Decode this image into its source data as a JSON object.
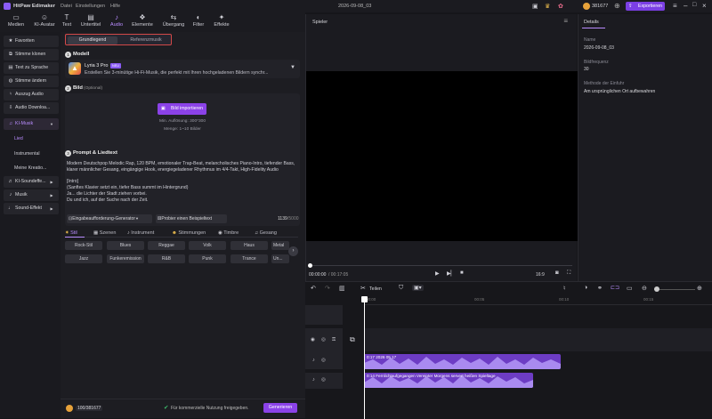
{
  "app": {
    "name": "HitPaw Edimaker",
    "menu": [
      "Datei",
      "Einstellungen",
      "Hilfe"
    ],
    "project_title": "2026-09-08_03",
    "credits": "381677",
    "export_label": "Exportieren"
  },
  "toolbar": [
    {
      "label": "Medien",
      "icon": "folder-icon"
    },
    {
      "label": "KI-Avatar",
      "icon": "avatar-icon"
    },
    {
      "label": "Text",
      "icon": "text-icon"
    },
    {
      "label": "Untertitel",
      "icon": "subtitle-icon"
    },
    {
      "label": "Audio",
      "icon": "music-icon"
    },
    {
      "label": "Elemente",
      "icon": "elements-icon"
    },
    {
      "label": "Übergang",
      "icon": "transition-icon"
    },
    {
      "label": "Filter",
      "icon": "filter-icon"
    },
    {
      "label": "Effekte",
      "icon": "effects-icon"
    }
  ],
  "sidebar": {
    "items": [
      {
        "label": "Favoriten",
        "icon": "star-icon"
      },
      {
        "label": "Stimme klonen",
        "icon": "clone-voice-icon"
      },
      {
        "label": "Text zu Sprache",
        "icon": "tts-icon"
      },
      {
        "label": "Stimme ändern",
        "icon": "voice-change-icon"
      },
      {
        "label": "Auszug Audio",
        "icon": "mic-icon"
      },
      {
        "label": "Audio Downloa...",
        "icon": "download-icon"
      },
      {
        "label": "KI-Musik",
        "icon": "ai-music-icon"
      }
    ],
    "subitems": [
      "Lied",
      "Instrumental",
      "Meine Kreatio..."
    ],
    "items2": [
      {
        "label": "KI-Soundeffe...",
        "icon": "sound-effect-icon"
      },
      {
        "label": "Musik",
        "icon": "music-note-icon"
      },
      {
        "label": "Sound-Effekt",
        "icon": "speaker-icon"
      }
    ]
  },
  "gen": {
    "tabs": [
      "Grundlegend",
      "Referenzmusik"
    ],
    "model_heading": "Modell",
    "model_name": "Lyria 3 Pro",
    "model_badge": "NEU",
    "model_desc": "Erstellen Sie 3-minütige Hi-Fi-Musik, die perfekt mit Ihren hochgeladenen Bildern synchr...",
    "image_heading": "Bild",
    "image_optional": "(Optional)",
    "import_label": "Bild importieren",
    "image_hint1": "Min. Auflösung: 300*300",
    "image_hint2": "Menge: 1~10 Bilder",
    "prompt_heading": "Prompt & Liedtext",
    "prompt_text": "Modern Deutschpop Melodic Rap, 120 BPM, emotionaler Trap-Beat, melancholisches Piano-Intro, tiefender Bass, klarer männlicher Gesang, eingängige Hook, energiegeladener Rhythmus im 4/4-Takt, High-Fidelity Audio\n\n[Intro]\n(Sanftes Klavier setzt ein, tiefer Bass summt im Hintergrund)\nJa... die Lichter der Stadt ziehen vorbei.\nDu und ich, auf der Suche nach der Zeit.",
    "prompt_gen_label": "Eingabeaufforderung-Generator",
    "example_label": "Probier einen Beispieltext",
    "char_count": "1139",
    "char_max": "/5000",
    "style_tabs": [
      "Stil",
      "Szenen",
      "Instrument",
      "Stimmungen",
      "Timbre",
      "Gesang"
    ],
    "styles_row1": [
      "Rock-Stil",
      "Blues",
      "Reggae",
      "Volk",
      "Haus",
      "Metal"
    ],
    "styles_row2": [
      "Jazz",
      "Funkeremission",
      "R&B",
      "Punk",
      "Trance",
      "Un..."
    ],
    "credits_used": "100/381677",
    "commercial_text": "Für kommerzielle Nutzung freigegeben.",
    "generate_label": "Generieren"
  },
  "player": {
    "title": "Spieler",
    "time_current": "00:00:00",
    "time_total": "/ 00:17:05",
    "ratio": "16:9"
  },
  "details": {
    "tab": "Details",
    "name_label": "Name",
    "name_value": "2026-09-08_03",
    "fps_label": "Bildfrequenz",
    "fps_value": "30",
    "method_label": "Methode der Einfuhr",
    "method_value": "Am ursprünglichen Ort aufbewahren"
  },
  "timeline": {
    "split_label": "Teilen",
    "ruler": [
      "00:00",
      "00:05",
      "00:10",
      "00:15"
    ],
    "clip1_label": "0:17 2026 05 17",
    "clip2_label": "0:14 Fernlichtaufgegangen Vereinter Morgens servert heißen Spieltage"
  }
}
